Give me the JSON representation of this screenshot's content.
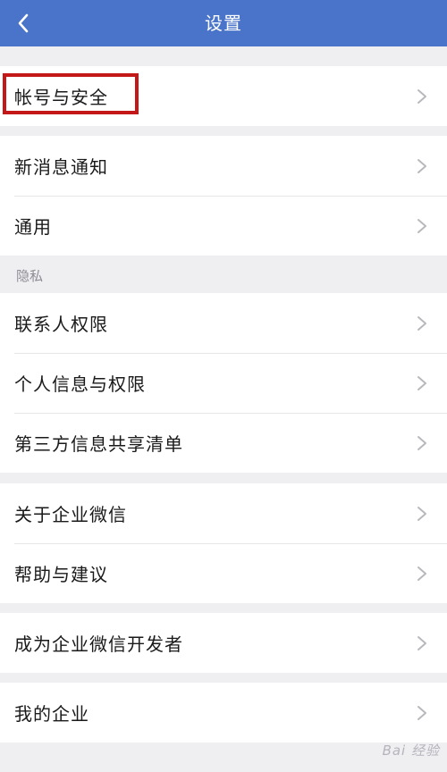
{
  "nav": {
    "title": "设置"
  },
  "groups": [
    {
      "items": [
        {
          "label": "帐号与安全"
        }
      ]
    },
    {
      "items": [
        {
          "label": "新消息通知"
        },
        {
          "label": "通用"
        }
      ]
    },
    {
      "section_label": "隐私",
      "items": [
        {
          "label": "联系人权限"
        },
        {
          "label": "个人信息与权限"
        },
        {
          "label": "第三方信息共享清单"
        }
      ]
    },
    {
      "items": [
        {
          "label": "关于企业微信"
        },
        {
          "label": "帮助与建议"
        }
      ]
    },
    {
      "items": [
        {
          "label": "成为企业微信开发者"
        }
      ]
    },
    {
      "items": [
        {
          "label": "我的企业"
        }
      ]
    }
  ],
  "watermark": "Bai 经验",
  "colors": {
    "nav_background": "#4a74c9",
    "page_background": "#efeff2",
    "highlight_border": "#c41717"
  },
  "icons": {
    "back": "chevron-left-icon",
    "row_arrow": "chevron-right-icon"
  }
}
